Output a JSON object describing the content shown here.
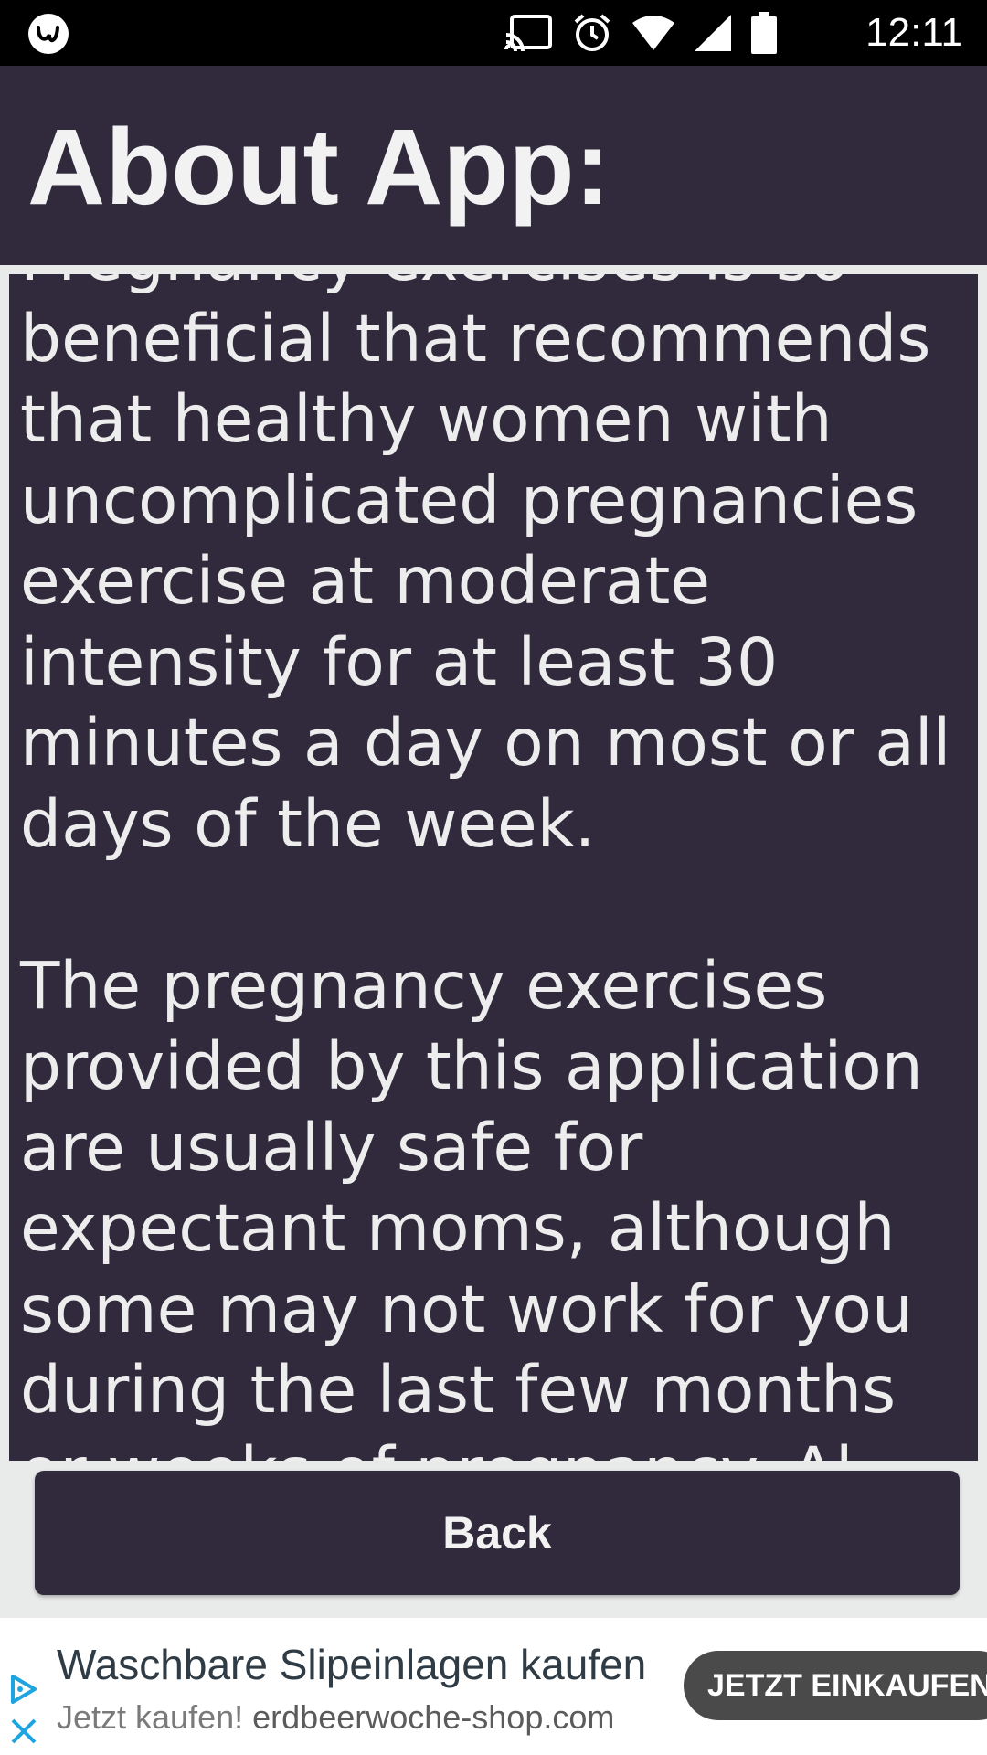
{
  "status_bar": {
    "time": "12:11",
    "icons": [
      "app-icon",
      "cast-icon",
      "alarm-icon",
      "wifi-icon",
      "signal-icon",
      "battery-icon"
    ]
  },
  "header": {
    "title": "About App:"
  },
  "content": {
    "text": "Pregnancy exercises is so beneficial that recommends that healthy women with uncomplicated pregnancies exercise at moderate intensity for at least 30 minutes a day on most or all days of the week.\n\nThe pregnancy exercises provided by this application are usually safe for expectant moms, although some may not work for you during the last few months or weeks of pregnancy. Al"
  },
  "back_button": {
    "label": "Back"
  },
  "ad": {
    "title": "Waschbare Slipeinlagen kaufen",
    "subtitle_prefix": "Jetzt kaufen!",
    "domain": "erdbeerwoche-shop.com",
    "cta": "JETZT EINKAUFEN"
  },
  "colors": {
    "primary": "#312a3c",
    "background": "#e9eaea",
    "text": "#ededed"
  }
}
